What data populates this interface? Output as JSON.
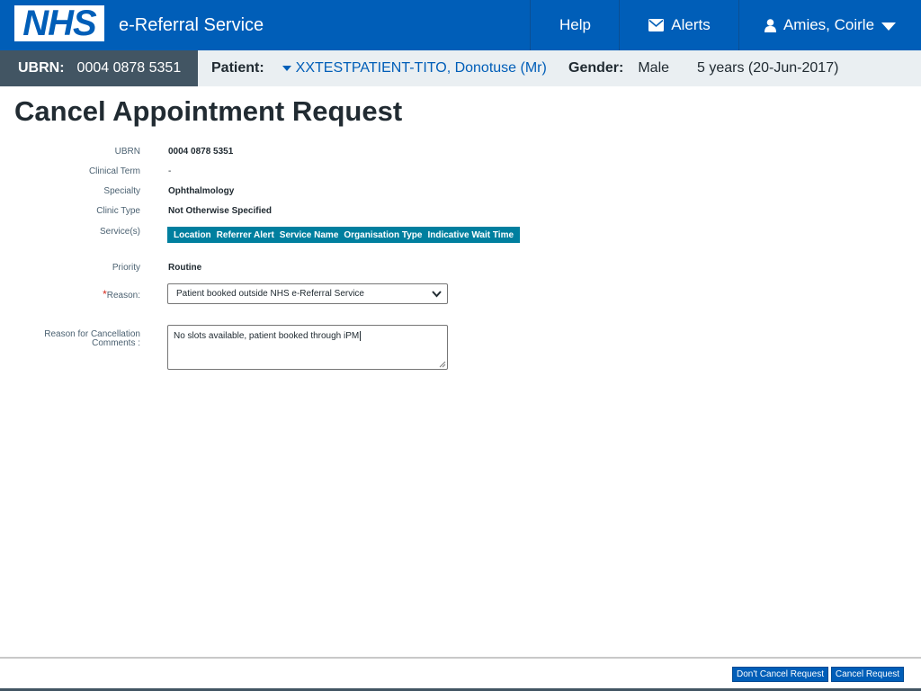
{
  "header": {
    "logo_text": "NHS",
    "service_name": "e-Referral Service",
    "help_label": "Help",
    "alerts_label": "Alerts",
    "user_name": "Amies, Coirle"
  },
  "banner": {
    "ubrn_label": "UBRN:",
    "ubrn_value": "0004 0878 5351",
    "patient_label": "Patient:",
    "patient_name": "XXTESTPATIENT-TITO, Donotuse (Mr)",
    "gender_label": "Gender:",
    "gender_value": "Male",
    "age": "5 years (20-Jun-2017)"
  },
  "page_title": "Cancel Appointment Request",
  "form": {
    "ubrn_label": "UBRN",
    "ubrn_value": "0004 0878 5351",
    "clinical_term_label": "Clinical Term",
    "clinical_term_value": "-",
    "specialty_label": "Specialty",
    "specialty_value": "Ophthalmology",
    "clinic_type_label": "Clinic Type",
    "clinic_type_value": "Not Otherwise Specified",
    "services_label": "Service(s)",
    "services_columns": [
      "Location",
      "Referrer Alert",
      "Service Name",
      "Organisation Type",
      "Indicative Wait Time"
    ],
    "priority_label": "Priority",
    "priority_value": "Routine",
    "reason_required_mark": "*",
    "reason_label": "Reason:",
    "reason_selected": "Patient booked outside NHS e-Referral Service",
    "comments_label_line1": "Reason for Cancellation",
    "comments_label_line2": "Comments :",
    "comments_value": "No slots available, patient booked through iPM"
  },
  "footer": {
    "dont_cancel_label": "Don't Cancel Request",
    "cancel_label": "Cancel Request"
  },
  "colors": {
    "header_blue": "#005eb8",
    "ubrn_box": "#425563",
    "services_bar": "#007f9f",
    "required_red": "#d5281b"
  },
  "icons": {
    "alerts": "envelope-icon",
    "user": "user-icon",
    "user_menu": "caret-down-icon",
    "patient_toggle": "triangle-down-icon",
    "select": "chevron-down-icon"
  }
}
